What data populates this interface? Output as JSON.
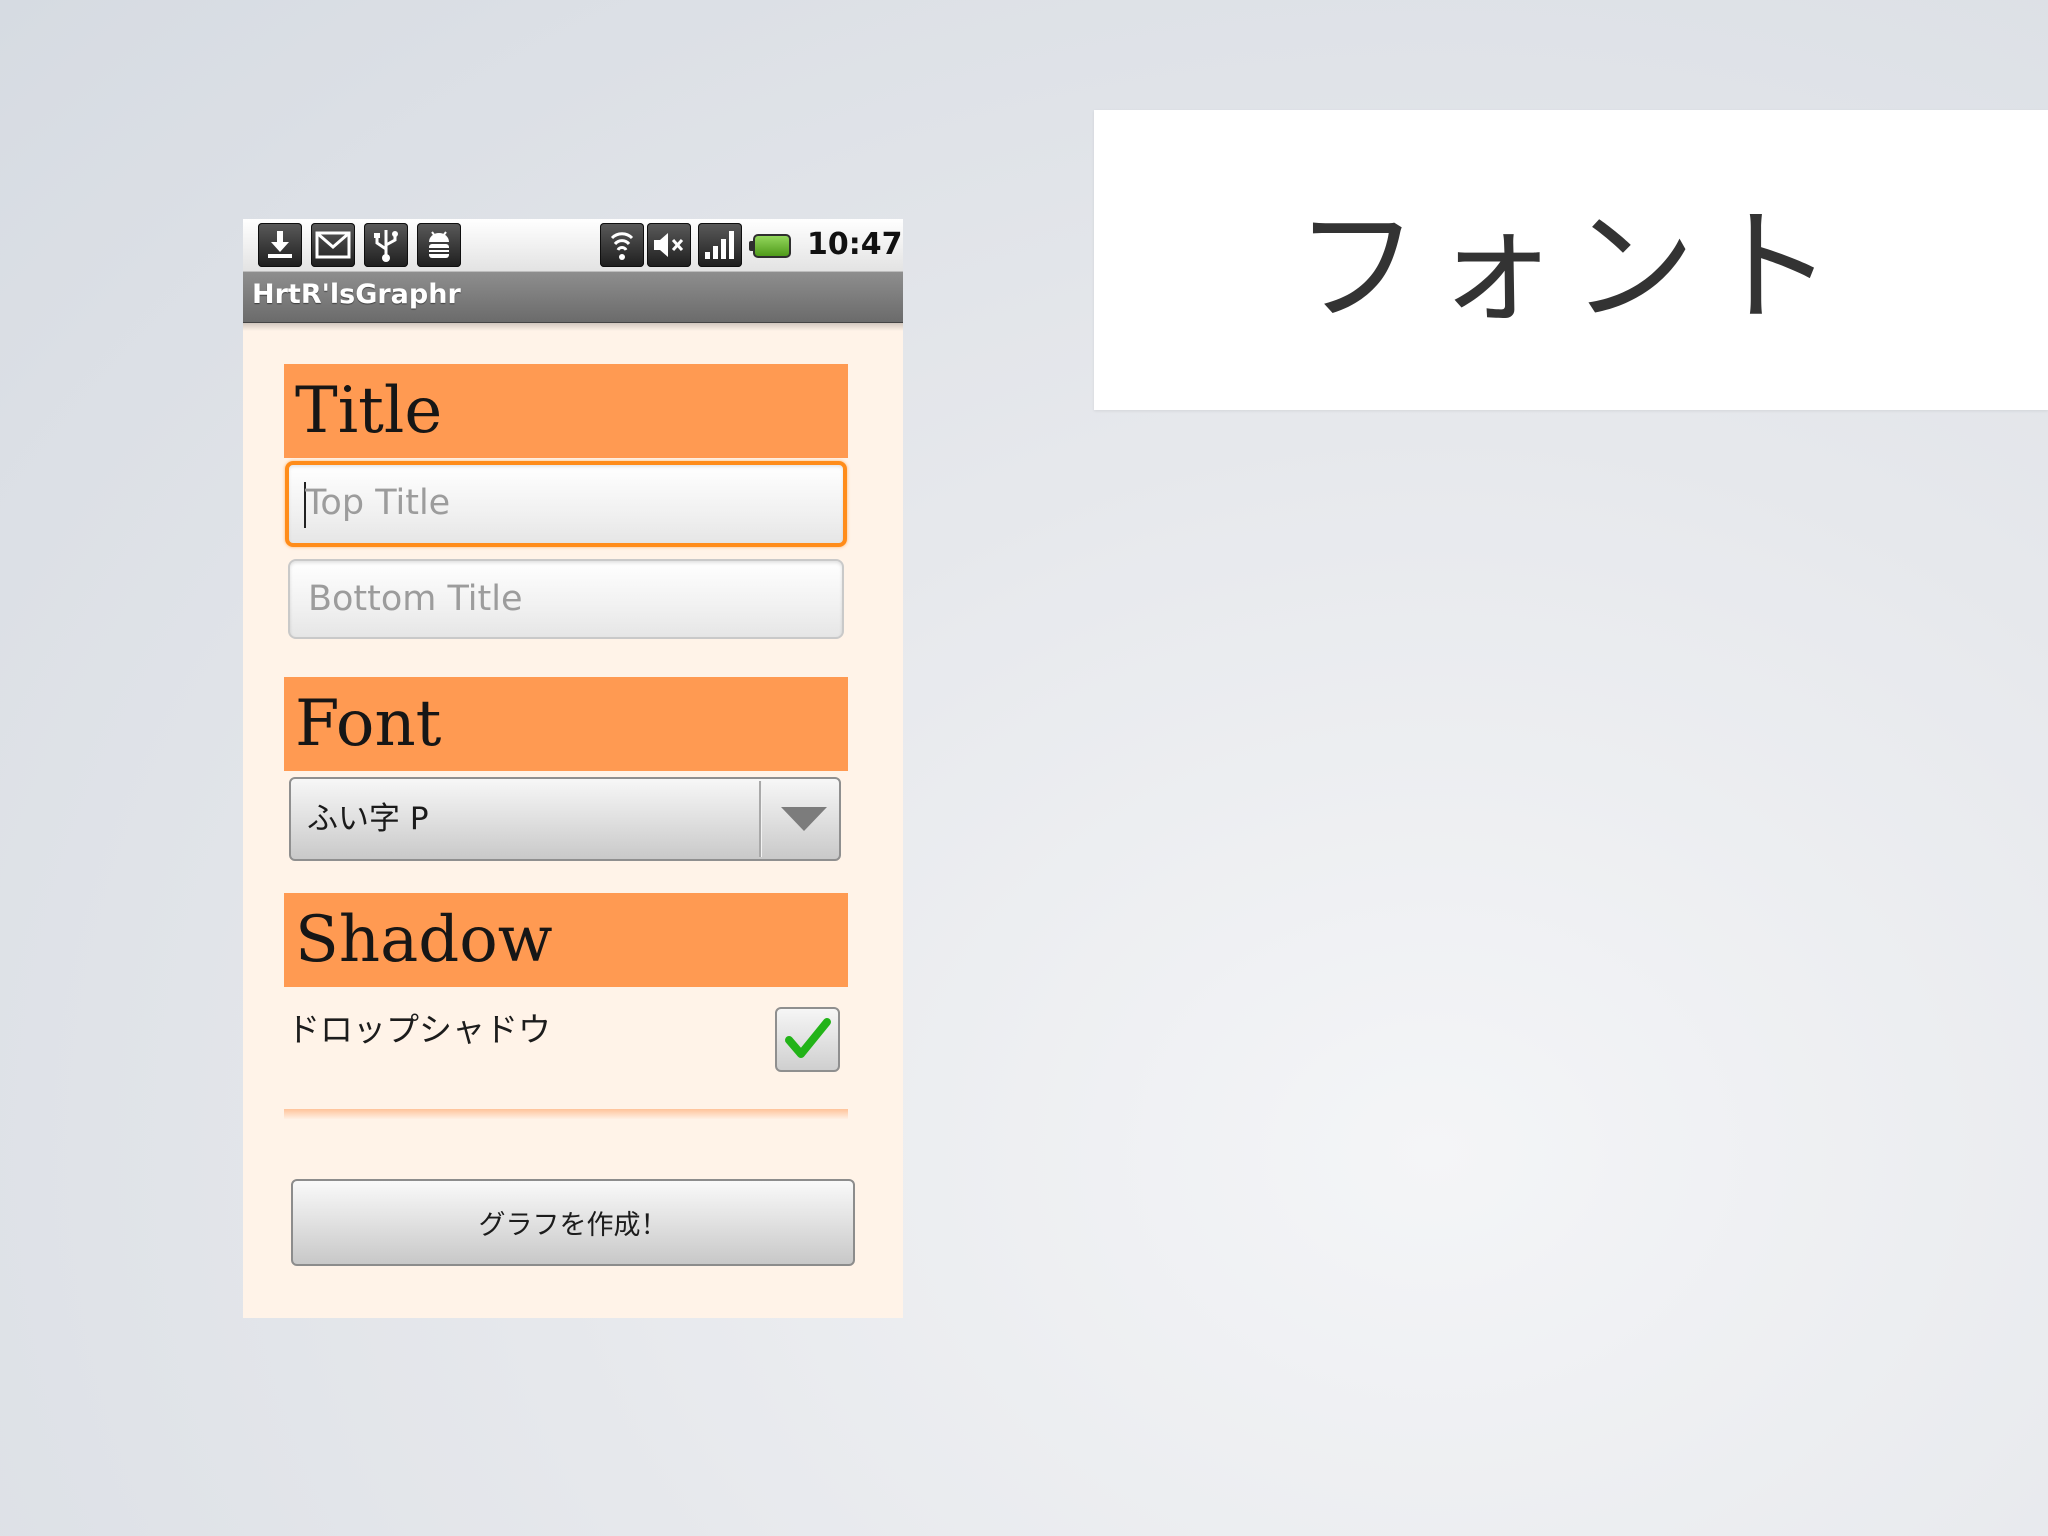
{
  "slide": {
    "title": "フォント"
  },
  "status_bar": {
    "icons": [
      "download-icon",
      "gmail-icon",
      "usb-icon",
      "android-debug-icon",
      "wifi-icon",
      "sound-muted-icon",
      "signal-icon",
      "battery-icon"
    ],
    "time": "10:47"
  },
  "app": {
    "title": "HrtR'lsGraphr"
  },
  "sections": {
    "title": {
      "header": "Title",
      "top_field": {
        "value": "",
        "placeholder": "Top Title"
      },
      "bottom_field": {
        "value": "",
        "placeholder": "Bottom Title"
      }
    },
    "font": {
      "header": "Font",
      "selected": "ふい字 P"
    },
    "shadow": {
      "header": "Shadow",
      "checkbox_label": "ドロップシャドウ",
      "checked": true
    }
  },
  "actions": {
    "create_label": "グラフを作成！"
  },
  "colors": {
    "section_header": "#ff9a52",
    "screen_background": "#fff3e8",
    "focus_border": "#ff8c1a",
    "check_green": "#22b318"
  }
}
